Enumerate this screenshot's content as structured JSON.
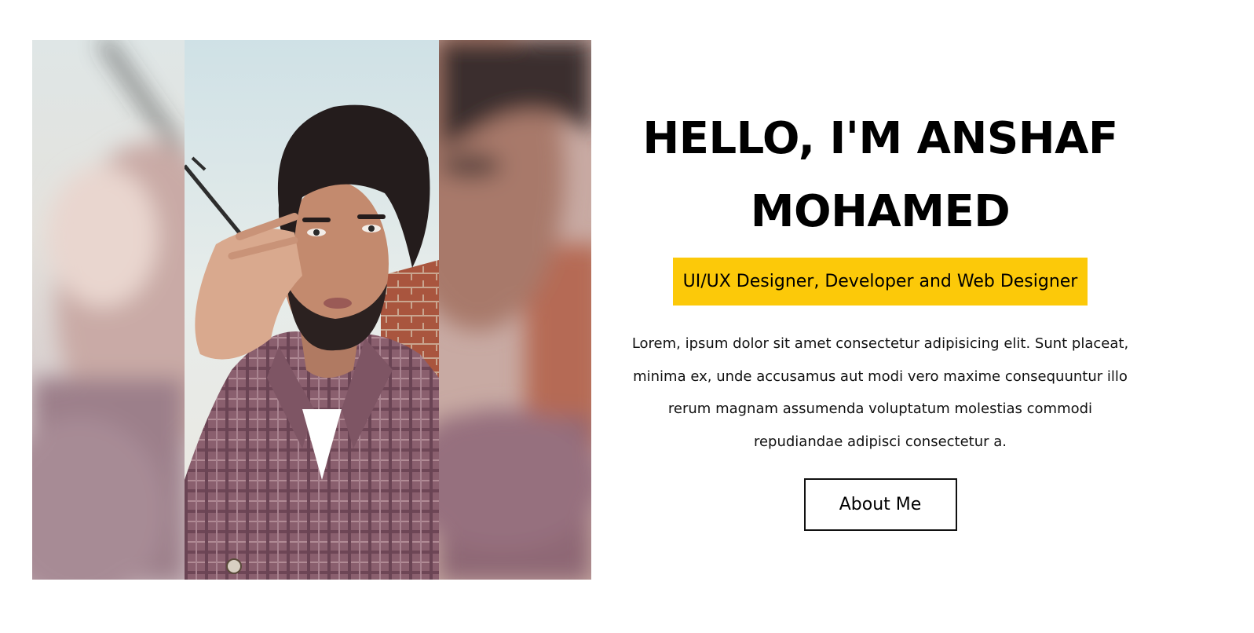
{
  "hero": {
    "headline_line1": "HELLO, I'M ANSHAF",
    "headline_line2": "MOHAMED",
    "role": "UI/UX Designer, Developer and Web Designer",
    "intro": "Lorem, ipsum dolor sit amet consectetur adipisicing elit. Sunt placeat, minima ex, unde accusamus aut modi vero maxime consequuntur illo rerum magnam assumenda voluptatum molestias commodi repudiandae adipisci consectetur a.",
    "about_button": "About Me"
  },
  "colors": {
    "accent": "#fcc909",
    "text": "#000000",
    "background": "#ffffff"
  }
}
